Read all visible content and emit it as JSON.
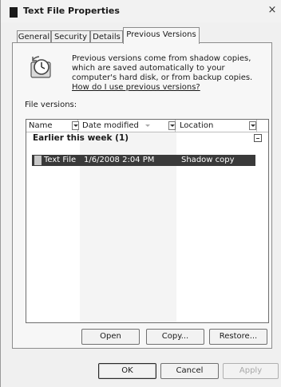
{
  "window": {
    "title": "Text File Properties",
    "close_glyph": "×"
  },
  "tabs": [
    {
      "label": "General"
    },
    {
      "label": "Security"
    },
    {
      "label": "Details"
    },
    {
      "label": "Previous Versions",
      "active": true
    }
  ],
  "previous_versions": {
    "icon": "restore-clock-icon",
    "description": "Previous versions come from shadow copies, which are saved automatically to your computer's hard disk, or from backup copies.",
    "help_link": "How do I use previous versions?",
    "file_versions_label": "File versions:",
    "columns": [
      "Name",
      "Date modified",
      "Location"
    ],
    "groups": [
      {
        "label": "Earlier this week (1)",
        "items": [
          {
            "name": "Text File",
            "date_modified": "1/6/2008 2:04 PM",
            "location": "Shadow copy",
            "selected": true
          }
        ]
      }
    ],
    "buttons": {
      "open": "Open",
      "copy": "Copy...",
      "restore": "Restore..."
    }
  },
  "footer": {
    "ok": "OK",
    "cancel": "Cancel",
    "apply": "Apply"
  },
  "colors": {
    "selection": "#3a3a3a",
    "panel": "#f7f7f7",
    "window": "#f0f0f0"
  }
}
